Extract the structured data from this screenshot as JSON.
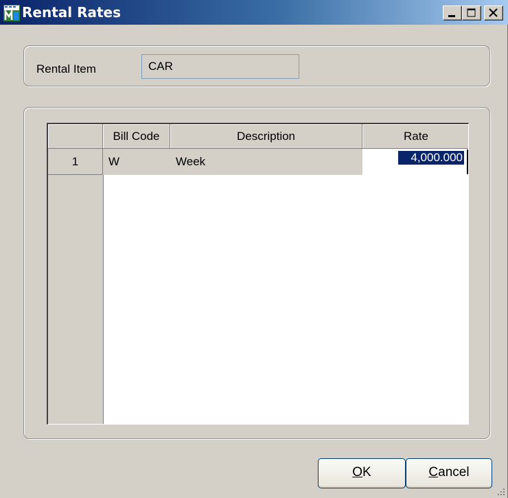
{
  "window": {
    "title": "Rental Rates"
  },
  "rental_item": {
    "label": "Rental Item",
    "value": "CAR"
  },
  "grid": {
    "columns": [
      "",
      "Bill Code",
      "Description",
      "Rate"
    ],
    "rows": [
      {
        "row_num": "1",
        "bill_code": "W",
        "description": "Week",
        "rate": "4,000.000"
      }
    ]
  },
  "buttons": {
    "ok_mnemonic": "O",
    "ok_rest": "K",
    "cancel_mnemonic": "C",
    "cancel_rest": "ancel"
  },
  "colors": {
    "titlebar_start": "#0a246a",
    "selection": "#0a246a",
    "dialog_bg": "#d4d0c8"
  },
  "icons": {
    "app": "sage-mas-app-icon",
    "minimize": "minimize-icon",
    "maximize": "maximize-icon",
    "close": "close-icon",
    "resize": "resize-grip-icon"
  }
}
